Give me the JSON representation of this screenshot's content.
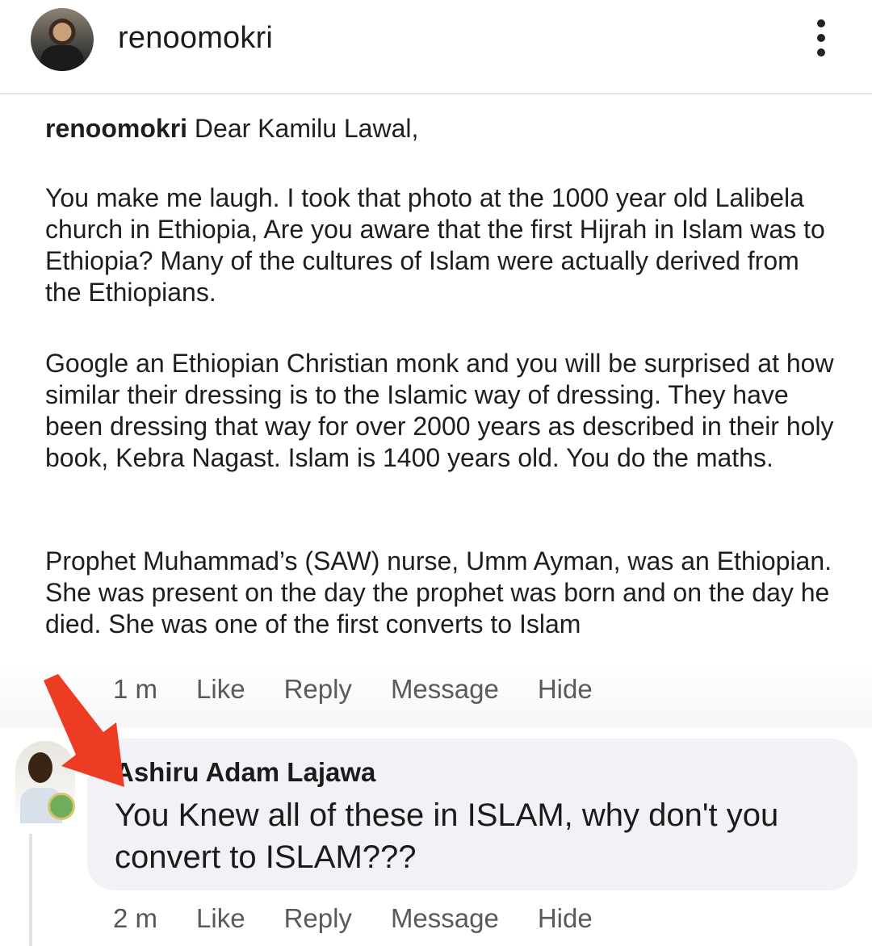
{
  "header": {
    "username": "renoomokri",
    "more_icon": "more-vertical-icon"
  },
  "caption": {
    "author": "renoomokri",
    "greeting": "Dear Kamilu Lawal,",
    "paragraphs": [
      "You make me laugh. I took that photo at the 1000 year old Lalibela church in Ethiopia, Are you aware that the first Hijrah in Islam was to Ethiopia? Many of the cultures of Islam were actually derived from the Ethiopians.",
      "Google an Ethiopian Christian monk and you will be surprised at how similar their dressing is to the Islamic way of dressing. They have been dressing that way for over 2000 years as described in their holy book, Kebra Nagast. Islam is 1400 years old. You do the maths.",
      "Prophet Muhammad’s (SAW) nurse, Umm Ayman, was an Ethiopian. She was present on the day the prophet was born and on the day he died. She was one of the first converts to Islam"
    ]
  },
  "post_actions": {
    "time": "1 m",
    "like": "Like",
    "reply": "Reply",
    "message": "Message",
    "hide": "Hide"
  },
  "comment": {
    "author": "Ashiru Adam Lajawa",
    "text": "You Knew all of these in ISLAM, why don't you convert to ISLAM???",
    "time": "2 m",
    "like": "Like",
    "reply": "Reply",
    "message": "Message",
    "hide": "Hide"
  },
  "colors": {
    "annotation_arrow": "#ee3b24",
    "bubble": "#f1f2f6"
  }
}
